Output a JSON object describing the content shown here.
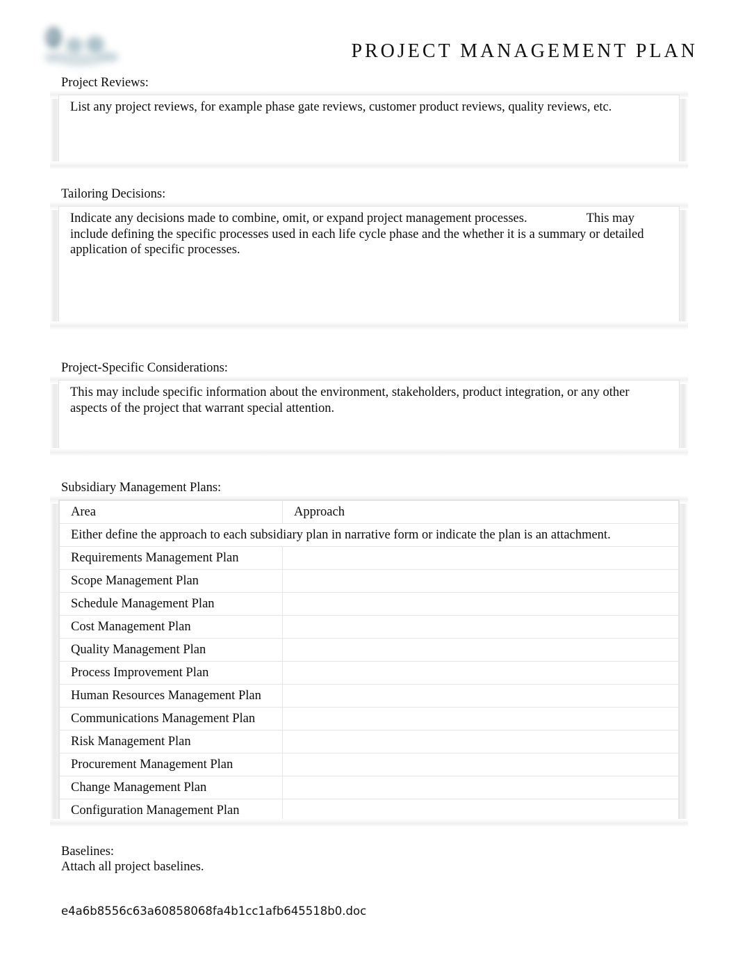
{
  "header": {
    "title": "PROJECT MANAGEMENT PLAN",
    "logo_icon": "company-logo-watermark"
  },
  "sections": {
    "project_reviews": {
      "label": "Project Reviews:",
      "body": "List any project reviews, for example phase gate reviews, customer product reviews, quality reviews, etc."
    },
    "tailoring_decisions": {
      "label": "Tailoring Decisions:",
      "body_part1": "Indicate any decisions made to combine, omit, or expand project management processes.",
      "body_part2": "This may include defining the specific processes used in each life cycle phase and the whether it is a summary or detailed application of specific processes."
    },
    "project_specific_considerations": {
      "label": "Project-Specific Considerations:",
      "body": "This may include specific information about the environment, stakeholders, product integration, or any other aspects of the project that warrant special attention."
    },
    "subsidiary_management_plans": {
      "label": "Subsidiary Management Plans:",
      "columns": [
        "Area",
        "Approach"
      ],
      "instruction": "Either define the approach to each subsidiary plan in narrative form or indicate the plan is an attachment.",
      "rows": [
        {
          "area": "Requirements Management Plan",
          "approach": ""
        },
        {
          "area": "Scope Management Plan",
          "approach": ""
        },
        {
          "area": "Schedule Management Plan",
          "approach": ""
        },
        {
          "area": "Cost Management Plan",
          "approach": ""
        },
        {
          "area": "Quality Management Plan",
          "approach": ""
        },
        {
          "area": "Process Improvement Plan",
          "approach": ""
        },
        {
          "area": "Human Resources Management Plan",
          "approach": ""
        },
        {
          "area": "Communications Management Plan",
          "approach": ""
        },
        {
          "area": "Risk Management Plan",
          "approach": ""
        },
        {
          "area": "Procurement Management Plan",
          "approach": ""
        },
        {
          "area": "Change Management Plan",
          "approach": ""
        },
        {
          "area": "Configuration Management Plan",
          "approach": ""
        }
      ]
    },
    "baselines": {
      "label": "Baselines:",
      "body": "Attach all project baselines."
    }
  },
  "footer": {
    "filename": "e4a6b8556c63a60858068fa4b1cc1afb645518b0.doc"
  },
  "colors": {
    "text": "#0c0c0c",
    "box_border": "#e2e2e2",
    "logo_tint": "#7d99a5"
  }
}
